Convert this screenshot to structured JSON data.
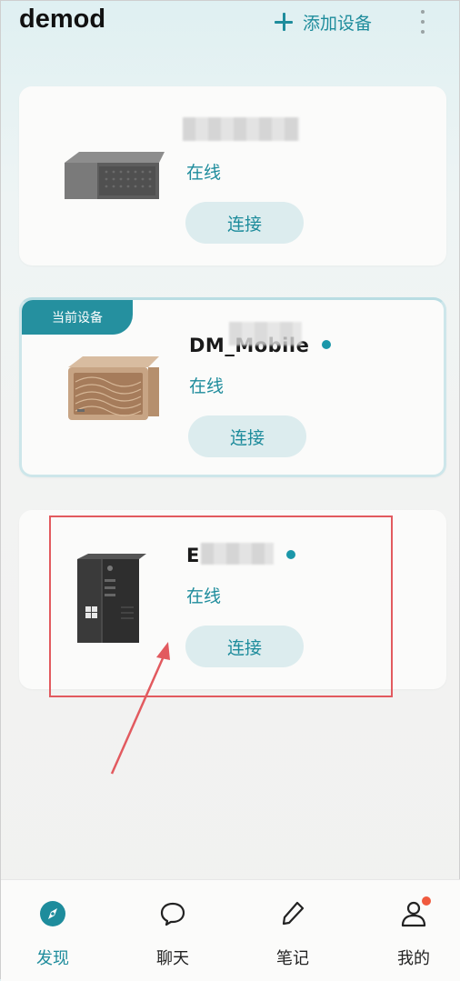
{
  "header": {
    "app_title": "demod",
    "add_device_label": "添加设备"
  },
  "devices": [
    {
      "name_visible": "",
      "status": "在线",
      "connect_label": "连接",
      "is_current": false
    },
    {
      "name_visible": "DM_Mobile",
      "badge": "当前设备",
      "status": "在线",
      "connect_label": "连接",
      "is_current": true
    },
    {
      "name_visible": "E",
      "status": "在线",
      "connect_label": "连接",
      "is_current": false
    }
  ],
  "tabbar": {
    "items": [
      {
        "label": "发现",
        "icon": "compass-icon",
        "active": true
      },
      {
        "label": "聊天",
        "icon": "chat-bubble-icon",
        "active": false
      },
      {
        "label": "笔记",
        "icon": "pen-icon",
        "active": false
      },
      {
        "label": "我的",
        "icon": "user-icon",
        "active": false,
        "has_notification": true
      }
    ]
  },
  "colors": {
    "accent": "#1e8c9c",
    "badge_bg": "#25909f",
    "connect_bg": "#dcecee",
    "highlight_red": "#e25a5f",
    "notification": "#f05a3e"
  }
}
